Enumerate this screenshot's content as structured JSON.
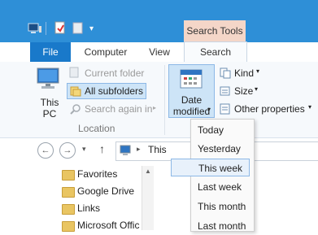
{
  "ribbon": {
    "context_tab": "Search Tools",
    "tabs": [
      "File",
      "Computer",
      "View",
      "Search"
    ],
    "this_pc_label": "This PC",
    "location": {
      "current_folder": "Current folder",
      "all_subfolders": "All subfolders",
      "search_again_in": "Search again in",
      "group_label": "Location"
    },
    "refine": {
      "date_modified": "Date modified",
      "kind": "Kind",
      "size": "Size",
      "other_properties": "Other properties"
    }
  },
  "address": {
    "path": "This"
  },
  "navpane": {
    "items": [
      "Favorites",
      "Google Drive",
      "Links",
      "Microsoft Offic"
    ]
  },
  "date_menu": {
    "items": [
      "Today",
      "Yesterday",
      "This week",
      "Last week",
      "This month",
      "Last month"
    ],
    "highlighted": "This week"
  },
  "colors": {
    "titlebar": "#2e8fd7",
    "file_tab": "#1979ca",
    "context_tab": "#f4d6c8",
    "highlight": "#e8f1fb"
  }
}
